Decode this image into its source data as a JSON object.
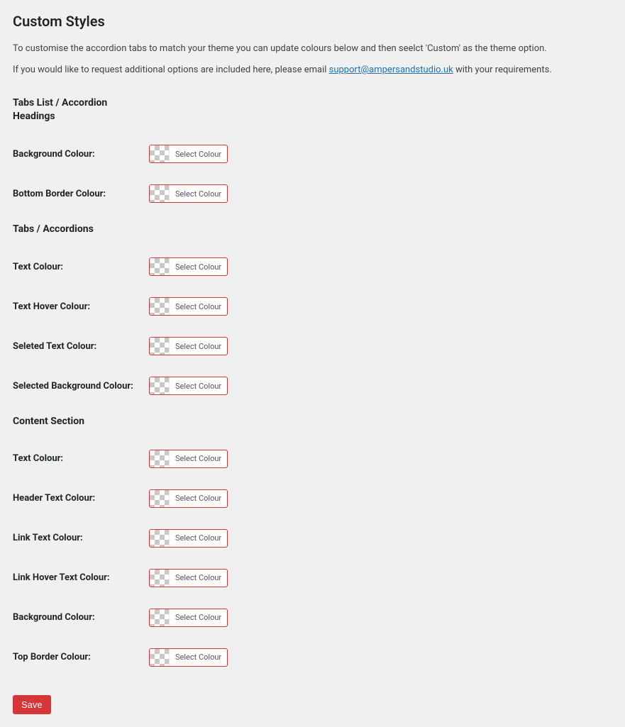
{
  "title": "Custom Styles",
  "intro": {
    "line1": "To customise the accordion tabs to match your theme you can update colours below and then seelct 'Custom' as the theme option.",
    "line2_before": "If you would like to request additional options are included here, please email ",
    "email": "support@ampersandstudio.uk",
    "line2_after": " with your requirements."
  },
  "select_colour_label": "Select Colour",
  "sections": {
    "tabs_list": {
      "heading": "Tabs List / Accordion Headings",
      "fields": {
        "background_colour": "Background Colour:",
        "bottom_border_colour": "Bottom Border Colour:"
      }
    },
    "tabs_accordions": {
      "heading": "Tabs / Accordions",
      "fields": {
        "text_colour": "Text Colour:",
        "text_hover_colour": "Text Hover Colour:",
        "selected_text_colour": "Seleted Text Colour:",
        "selected_background_colour": "Selected Background Colour:"
      }
    },
    "content_section": {
      "heading": "Content Section",
      "fields": {
        "text_colour": "Text Colour:",
        "header_text_colour": "Header Text Colour:",
        "link_text_colour": "Link Text Colour:",
        "link_hover_text_colour": "Link Hover Text Colour:",
        "background_colour": "Background Colour:",
        "top_border_colour": "Top Border Colour:"
      }
    }
  },
  "save_label": "Save"
}
